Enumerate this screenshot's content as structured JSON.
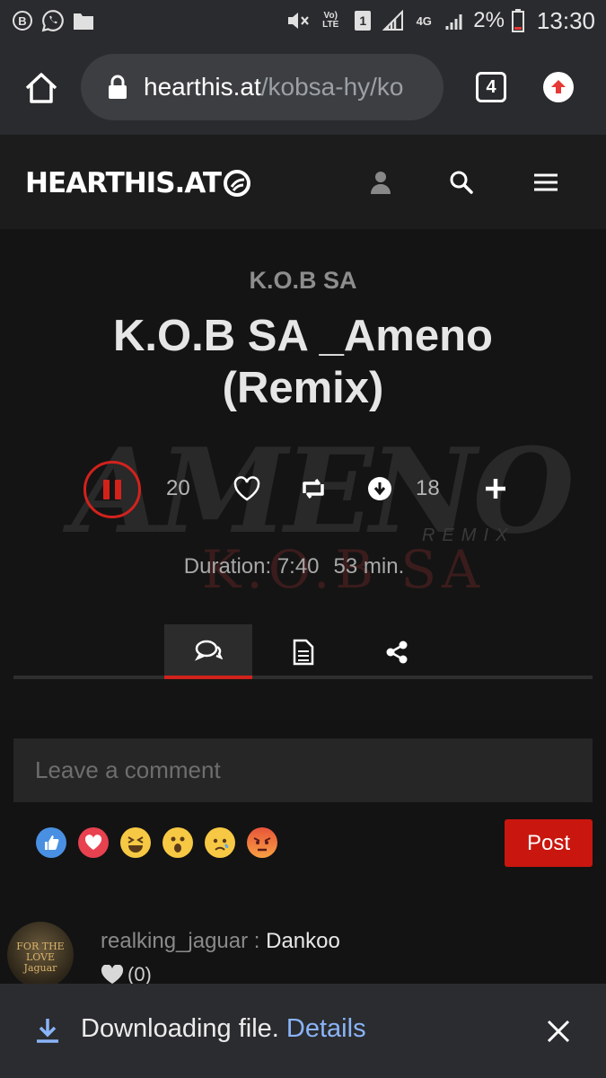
{
  "status_bar": {
    "left_icons": [
      "b-badge-icon",
      "whatsapp-icon",
      "folder-icon"
    ],
    "right_icons": [
      "mute-icon",
      "volte-icon",
      "sim1-icon",
      "signal-icon",
      "4g-icon",
      "signal-icon-2"
    ],
    "volte_label": "Vo) LTE",
    "sim_label": "1",
    "net_label": "4G",
    "battery": "2%",
    "time": "13:30"
  },
  "browser": {
    "url_host": "hearthis.at",
    "url_path": "/kobsa-hy/ko",
    "tab_count": "4"
  },
  "site": {
    "logo": "HEARTHIS.AT"
  },
  "track": {
    "artist": "K.O.B SA",
    "title": "K.O.B SA _Ameno (Remix)",
    "bg_word": "AMENO",
    "bg_sub": "REMIX",
    "bg_kob": "K.O.B SA",
    "play_count": "20",
    "download_count": "18",
    "duration": "Duration: 7:40",
    "age": "53 min."
  },
  "comments": {
    "placeholder": "Leave a comment",
    "post_label": "Post",
    "reactions": [
      "like-reaction",
      "love-reaction",
      "laugh-reaction",
      "wow-reaction",
      "sad-reaction",
      "angry-reaction"
    ],
    "items": [
      {
        "user": "realking_jaguar",
        "separator": ":",
        "text": "Dankoo",
        "likes": "(0)",
        "avatar_text": "FOR THE LOVE Jaguar"
      }
    ]
  },
  "download": {
    "message": "Downloading file.",
    "link": "Details"
  },
  "colors": {
    "accent": "#d2221c",
    "link": "#8ab4f8"
  }
}
